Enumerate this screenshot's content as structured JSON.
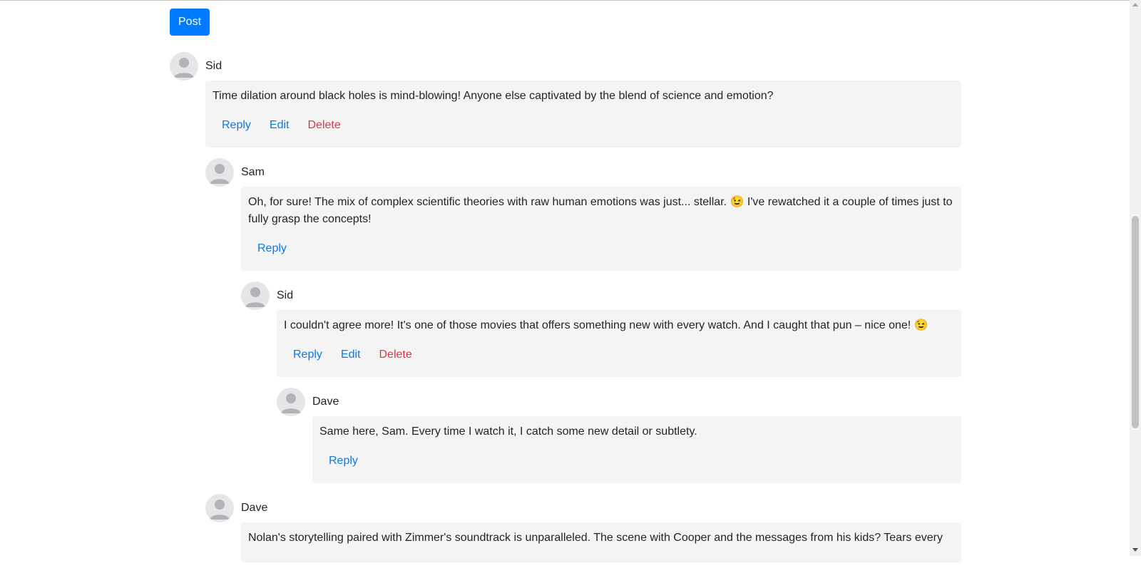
{
  "post_button": "Post",
  "comments": [
    {
      "author": "Sid",
      "text": "Time dilation around black holes is mind-blowing! Anyone else captivated by the blend of science and emotion?",
      "actions": [
        "Reply",
        "Edit",
        "Delete"
      ]
    },
    {
      "author": "Sam",
      "text": "Oh, for sure! The mix of complex scientific theories with raw human emotions was just... stellar. 😉 I've rewatched it a couple of times just to fully grasp the concepts!",
      "actions": [
        "Reply"
      ]
    },
    {
      "author": "Sid",
      "text": "I couldn't agree more! It's one of those movies that offers something new with every watch. And I caught that pun – nice one! 😉",
      "actions": [
        "Reply",
        "Edit",
        "Delete"
      ]
    },
    {
      "author": "Dave",
      "text": "Same here, Sam. Every time I watch it, I catch some new detail or subtlety.",
      "actions": [
        "Reply"
      ]
    },
    {
      "author": "Dave",
      "text": "Nolan's storytelling paired with Zimmer's soundtrack is unparalleled. The scene with Cooper and the messages from his kids? Tears every",
      "actions": []
    }
  ],
  "icons": {
    "avatar": "user-avatar-icon"
  },
  "colors": {
    "primary": "#007bff",
    "link": "#0d78e8",
    "danger": "#dc3545",
    "bubble_bg": "#f4f4f4"
  }
}
